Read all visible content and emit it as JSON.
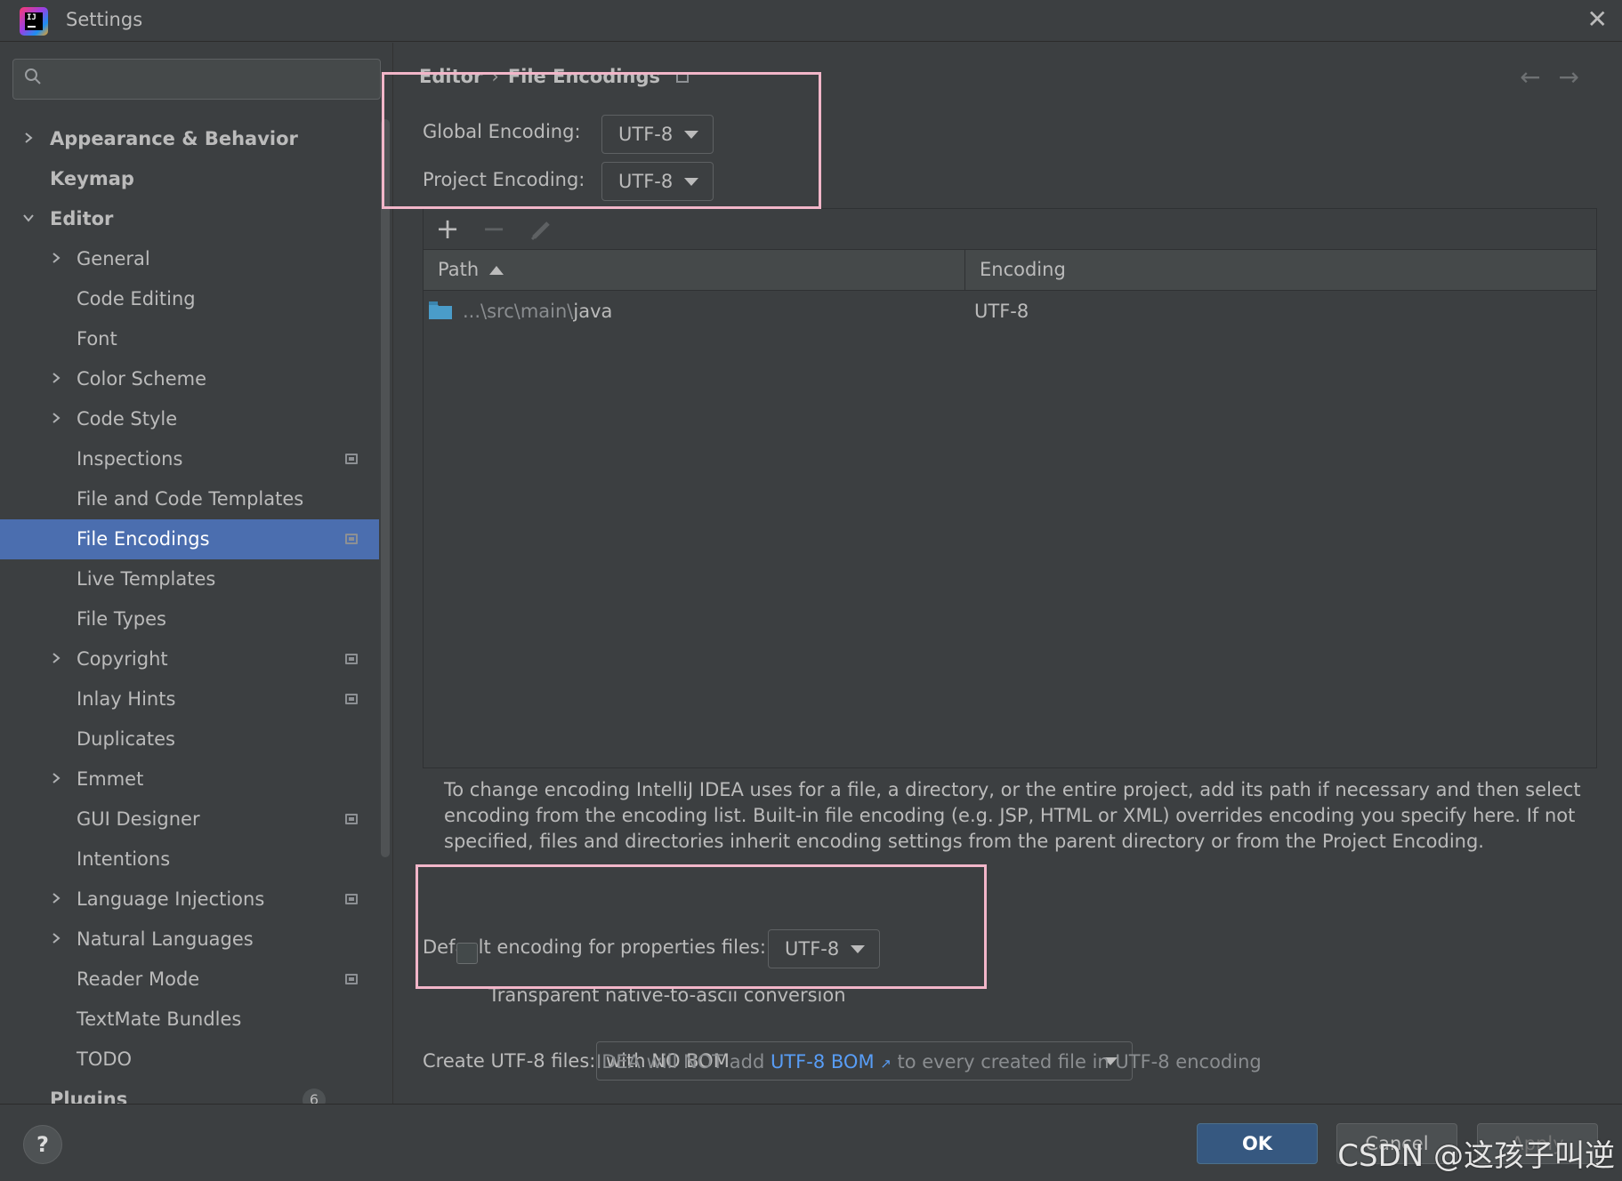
{
  "window": {
    "title": "Settings",
    "app_icon_text": "IJ"
  },
  "sidebar": {
    "search_placeholder": "",
    "items": [
      {
        "label": "Appearance & Behavior",
        "level": 0,
        "expandable": true,
        "expanded": false,
        "pinned": false
      },
      {
        "label": "Keymap",
        "level": 0,
        "expandable": false,
        "pinned": false
      },
      {
        "label": "Editor",
        "level": 0,
        "expandable": true,
        "expanded": true,
        "pinned": false
      },
      {
        "label": "General",
        "level": 1,
        "expandable": true,
        "expanded": false,
        "pinned": false
      },
      {
        "label": "Code Editing",
        "level": 1,
        "expandable": false,
        "pinned": false
      },
      {
        "label": "Font",
        "level": 1,
        "expandable": false,
        "pinned": false
      },
      {
        "label": "Color Scheme",
        "level": 1,
        "expandable": true,
        "expanded": false,
        "pinned": false
      },
      {
        "label": "Code Style",
        "level": 1,
        "expandable": true,
        "expanded": false,
        "pinned": false
      },
      {
        "label": "Inspections",
        "level": 1,
        "expandable": false,
        "pinned": true
      },
      {
        "label": "File and Code Templates",
        "level": 1,
        "expandable": false,
        "pinned": false
      },
      {
        "label": "File Encodings",
        "level": 1,
        "expandable": false,
        "pinned": true,
        "selected": true
      },
      {
        "label": "Live Templates",
        "level": 1,
        "expandable": false,
        "pinned": false
      },
      {
        "label": "File Types",
        "level": 1,
        "expandable": false,
        "pinned": false
      },
      {
        "label": "Copyright",
        "level": 1,
        "expandable": true,
        "expanded": false,
        "pinned": true
      },
      {
        "label": "Inlay Hints",
        "level": 1,
        "expandable": false,
        "pinned": true
      },
      {
        "label": "Duplicates",
        "level": 1,
        "expandable": false,
        "pinned": false
      },
      {
        "label": "Emmet",
        "level": 1,
        "expandable": true,
        "expanded": false,
        "pinned": false
      },
      {
        "label": "GUI Designer",
        "level": 1,
        "expandable": false,
        "pinned": true
      },
      {
        "label": "Intentions",
        "level": 1,
        "expandable": false,
        "pinned": false
      },
      {
        "label": "Language Injections",
        "level": 1,
        "expandable": true,
        "expanded": false,
        "pinned": true
      },
      {
        "label": "Natural Languages",
        "level": 1,
        "expandable": true,
        "expanded": false,
        "pinned": false
      },
      {
        "label": "Reader Mode",
        "level": 1,
        "expandable": false,
        "pinned": true
      },
      {
        "label": "TextMate Bundles",
        "level": 1,
        "expandable": false,
        "pinned": false
      },
      {
        "label": "TODO",
        "level": 1,
        "expandable": false,
        "pinned": false
      },
      {
        "label": "Plugins",
        "level": 0,
        "expandable": false,
        "pinned": false,
        "count": "6"
      }
    ]
  },
  "main": {
    "breadcrumb": {
      "parent": "Editor",
      "current": "File Encodings"
    },
    "global_encoding": {
      "label": "Global Encoding:",
      "value": "UTF-8"
    },
    "project_encoding": {
      "label": "Project Encoding:",
      "value": "UTF-8"
    },
    "toolbar": {
      "add": "+",
      "remove": "−",
      "edit": "edit-icon"
    },
    "table": {
      "columns": [
        "Path",
        "Encoding"
      ],
      "sort_column": "Path",
      "rows": [
        {
          "path_prefix": "...\\src\\main\\",
          "path_name": "java",
          "encoding": "UTF-8"
        }
      ]
    },
    "description": "To change encoding IntelliJ IDEA uses for a file, a directory, or the entire project, add its path if necessary and then select encoding from the encoding list. Built-in file encoding (e.g. JSP, HTML or XML) overrides encoding you specify here. If not specified, files and directories inherit encoding settings from the parent directory or from the Project Encoding.",
    "properties_encoding": {
      "label": "Default encoding for properties files:",
      "value": "UTF-8"
    },
    "native_to_ascii": {
      "label": "Transparent native-to-ascii conversion",
      "checked": false
    },
    "create_utf8": {
      "label": "Create UTF-8 files:",
      "value": "with NO BOM"
    },
    "bom_hint": {
      "before": "IDEA will NOT add ",
      "link": "UTF-8 BOM",
      "link_arrow": "↗",
      "after": " to every created file in UTF-8 encoding"
    }
  },
  "footer": {
    "help": "?",
    "ok": "OK",
    "cancel": "Cancel",
    "apply": "Apply",
    "watermark": "CSDN @这孩子叫逆"
  },
  "colors": {
    "background": "#3c3f41",
    "selection": "#4b6eaf",
    "ok_button": "#365880",
    "link": "#589df6",
    "highlight_box": "#f2b6c9",
    "folder": "#4a9cc9"
  }
}
